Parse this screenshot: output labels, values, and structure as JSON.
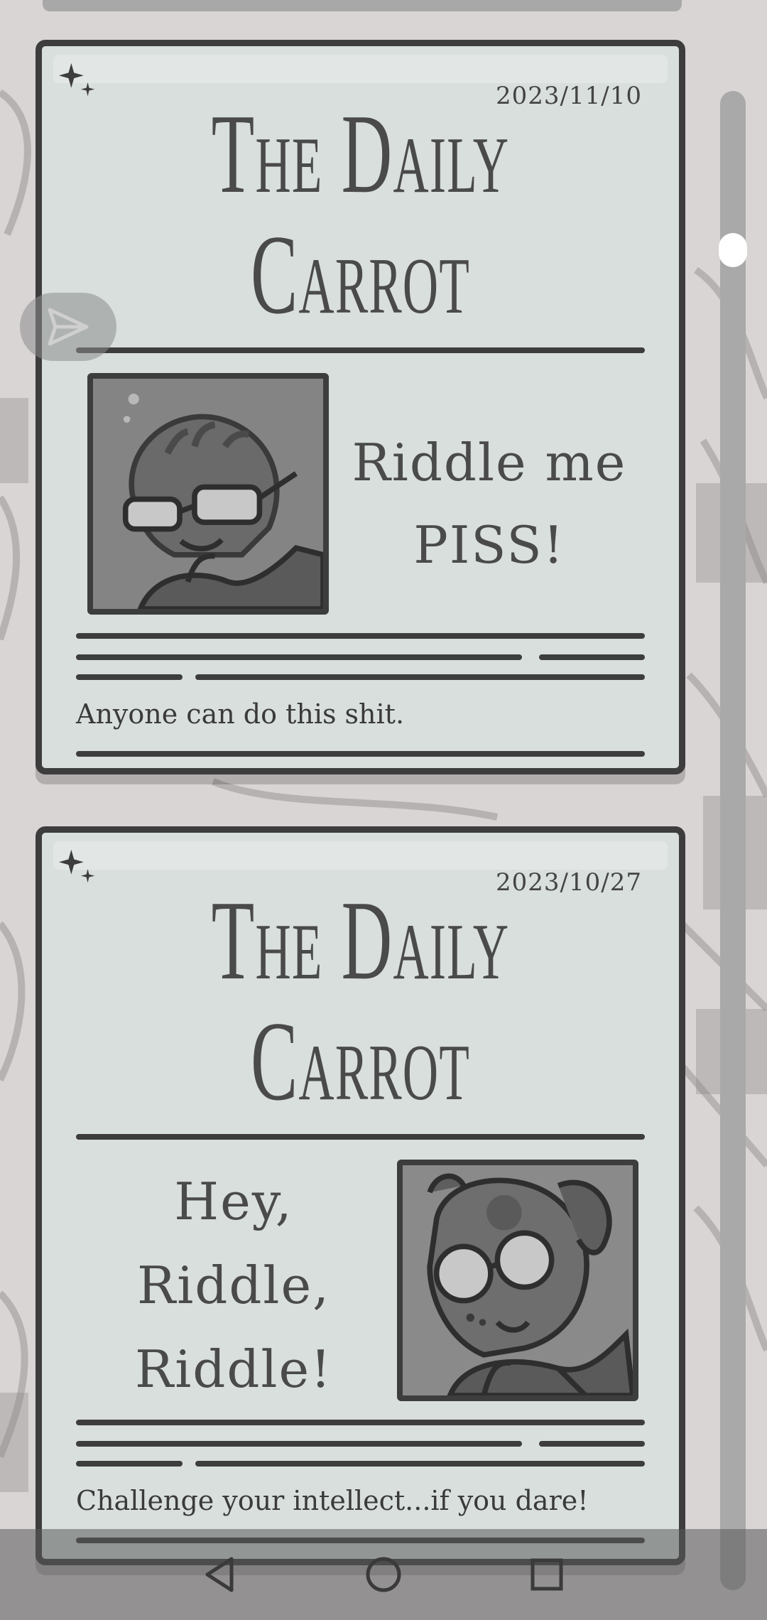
{
  "colors": {
    "background": "#d9d5d4",
    "card": "#d8dfdd",
    "ink": "#3d3d3d",
    "text": "#4a4a4a",
    "scroll_thumb": "#ffffff",
    "scroll_track": "#a9a9a9",
    "navbar": "#5a5a5a"
  },
  "cards": [
    {
      "date": "2023/11/10",
      "masthead": [
        "The Daily",
        "Carrot"
      ],
      "headline": [
        "Riddle me",
        "PISS!"
      ],
      "subline": "Anyone can do this shit.",
      "portrait_icon": "glasses-character-icon"
    },
    {
      "date": "2023/10/27",
      "masthead": [
        "The Daily",
        "Carrot"
      ],
      "headline": [
        "Hey,",
        "Riddle,",
        "Riddle!"
      ],
      "subline": "Challenge your intellect...if you dare!",
      "portrait_icon": "round-glasses-dog-icon"
    }
  ],
  "icons": {
    "sparkle": "sparkle-icon",
    "share": "send-icon",
    "back": "back-icon",
    "home": "home-icon",
    "recents": "recents-icon"
  }
}
